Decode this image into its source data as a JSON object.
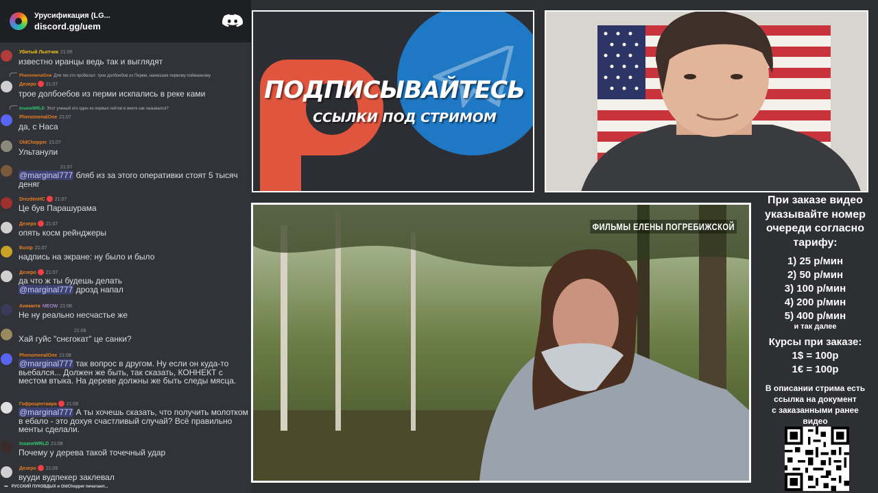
{
  "chat": {
    "server_name": "Урусификация (LG...",
    "server_invite": "discord.gg/uem",
    "typing_indicator": "РУССКИЙ ПУКОВДЫХ и OldChopper печатают...",
    "messages": [
      {
        "author": "Убитый Льотчик",
        "time": "21:06",
        "text": "известно иранцы ведь так и выглядят",
        "color": "#f1c40f",
        "badge": false,
        "reply": null
      },
      {
        "author": "Дезеро",
        "time": "21:07",
        "text": "трое долбоебов из перми искпались в реке ками",
        "color": "#e67e22",
        "badge": true,
        "reply": {
          "author": "PhenomenalOne",
          "text": "Для тех кто пробелал: трое долбоебов из Перми, нанесшие первому пойманному"
        }
      },
      {
        "author": "PhenomenalOne",
        "time": "21:07",
        "text": "да, с Наса",
        "color": "#e67e22",
        "badge": false,
        "reply": {
          "author": "InsaneWRLD",
          "text": "Этот ученый это один из первых гейтов в инете как назывался?"
        }
      },
      {
        "author": "OldChopper",
        "time": "21:07",
        "text": "Ультанули",
        "color": "#e67e22",
        "badge": false,
        "reply": null
      },
      {
        "author": "",
        "time": "21:07",
        "mention": "@marginal777",
        "text": " бляб из за этого оперативки стоят 5 тысяч деняг",
        "color": "#3498db",
        "badge": false,
        "reply": null
      },
      {
        "author": "DrezdenHC",
        "time": "21:07",
        "text": "Це був Парашурама",
        "color": "#e67e22",
        "badge": true,
        "reply": null
      },
      {
        "author": "Дезеро",
        "time": "21:07",
        "text": "опять косм рейнджеры",
        "color": "#e67e22",
        "badge": true,
        "reply": null
      },
      {
        "author": "Bustp",
        "time": "21:07",
        "text": "надпись на экране: ну было и было",
        "color": "#e67e22",
        "badge": false,
        "reply": null
      },
      {
        "author": "Дезеро",
        "time": "21:07",
        "mention": "",
        "text": "да что ж ты будешь делать",
        "mention2": "@marginal777",
        "text2": " дрозд напал",
        "color": "#e67e22",
        "badge": true,
        "reply": null
      },
      {
        "author": "Анимити",
        "time": "21:08",
        "tag": "MEOW",
        "text": "Не ну реально несчастье же",
        "color": "#e67e22",
        "badge": false,
        "reply": null
      },
      {
        "author": "",
        "time": "21:08",
        "text": "Хай гуйс \"снєгокат\" це санки?",
        "color": "#2ecc71",
        "badge": false,
        "reply": null
      },
      {
        "author": "PhenomenalOne",
        "time": "21:08",
        "mention": "@marginal777",
        "text": " так вопрос в другом. Ну если он куда-то вьебался... Должен же быть, так сказать, КОННЕКТ с местом втыка. На дереве должны же быть следы мясца.",
        "color": "#e67e22",
        "badge": false,
        "reply": null
      },
      {
        "author": "Гофроцентавра",
        "time": "21:08",
        "mention": "@marginal777",
        "text": " А ты хочешь сказать, что получить молотком в ебало - это дохуя счастливый случай? Всё правильно менты сделали.",
        "color": "#e67e22",
        "badge": true,
        "reply": null
      },
      {
        "author": "InsaneWRLD",
        "time": "21:08",
        "text": "Почему у дерева такой точечный удар",
        "color": "#2ecc71",
        "badge": false,
        "reply": null
      },
      {
        "author": "Дезеро",
        "time": "21:09",
        "text": "вууди вудпекер заклевал",
        "color": "#e67e22",
        "badge": true,
        "reply": null
      }
    ]
  },
  "promo": {
    "title": "ПОДПИСЫВАЙТЕСЬ",
    "subtitle": "ССЫЛКИ ПОД СТРИМОМ",
    "patreon_color": "#e0553e",
    "telegram_color": "#1f78c4"
  },
  "video": {
    "caption": "ФИЛЬМЫ ЕЛЕНЫ ПОГРЕБИЖСКОЙ"
  },
  "info": {
    "intro": [
      "При заказе видео",
      "указывайте номер",
      "очереди согласно",
      "тарифу:"
    ],
    "tariffs": [
      "1) 25 р/мин",
      "2) 50 р/мин",
      "3) 100 р/мин",
      "4) 200 р/мин",
      "5) 400 р/мин"
    ],
    "tariffs_more": "и так далее",
    "rates": [
      "Курсы при заказе:",
      "1$ = 100р",
      "1€ = 100р"
    ],
    "description": [
      "В описании стрима есть",
      "ссылка на документ",
      "с заказанными ранее",
      "видео"
    ]
  }
}
